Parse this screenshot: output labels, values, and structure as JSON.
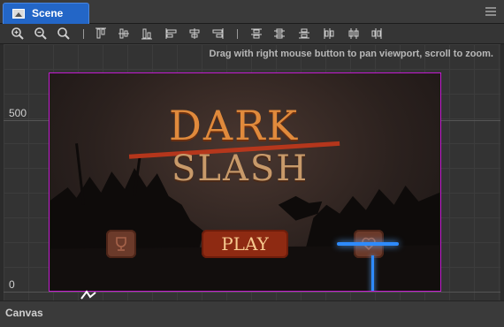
{
  "tab": {
    "label": "Scene",
    "icon": "scene-image-icon"
  },
  "panel_menu_icon": "hamburger-menu-icon",
  "toolbar": {
    "tools": [
      {
        "name": "zoom-in-icon"
      },
      {
        "name": "zoom-out-icon"
      },
      {
        "name": "zoom-reset-icon"
      },
      {
        "name": "align-top-icon"
      },
      {
        "name": "align-vertical-center-icon"
      },
      {
        "name": "align-bottom-icon"
      },
      {
        "name": "align-left-icon"
      },
      {
        "name": "align-horizontal-center-icon"
      },
      {
        "name": "align-right-icon"
      },
      {
        "name": "distribute-top-icon"
      },
      {
        "name": "distribute-vertical-center-icon"
      },
      {
        "name": "distribute-bottom-icon"
      },
      {
        "name": "distribute-left-icon"
      },
      {
        "name": "distribute-horizontal-center-icon"
      },
      {
        "name": "distribute-right-icon"
      }
    ]
  },
  "viewport": {
    "hint": "Drag with right mouse button to pan viewport, scroll to zoom.",
    "axis_labels": {
      "y_500": "500",
      "y_0": "0"
    },
    "canvas_border_color": "#c21ad0"
  },
  "game": {
    "title_line1": "DARK",
    "title_line2": "SLASH",
    "play_label": "PLAY",
    "trophy_icon": "trophy-icon",
    "heart_icon": "heart-icon"
  },
  "bottom": {
    "label": "Canvas"
  }
}
